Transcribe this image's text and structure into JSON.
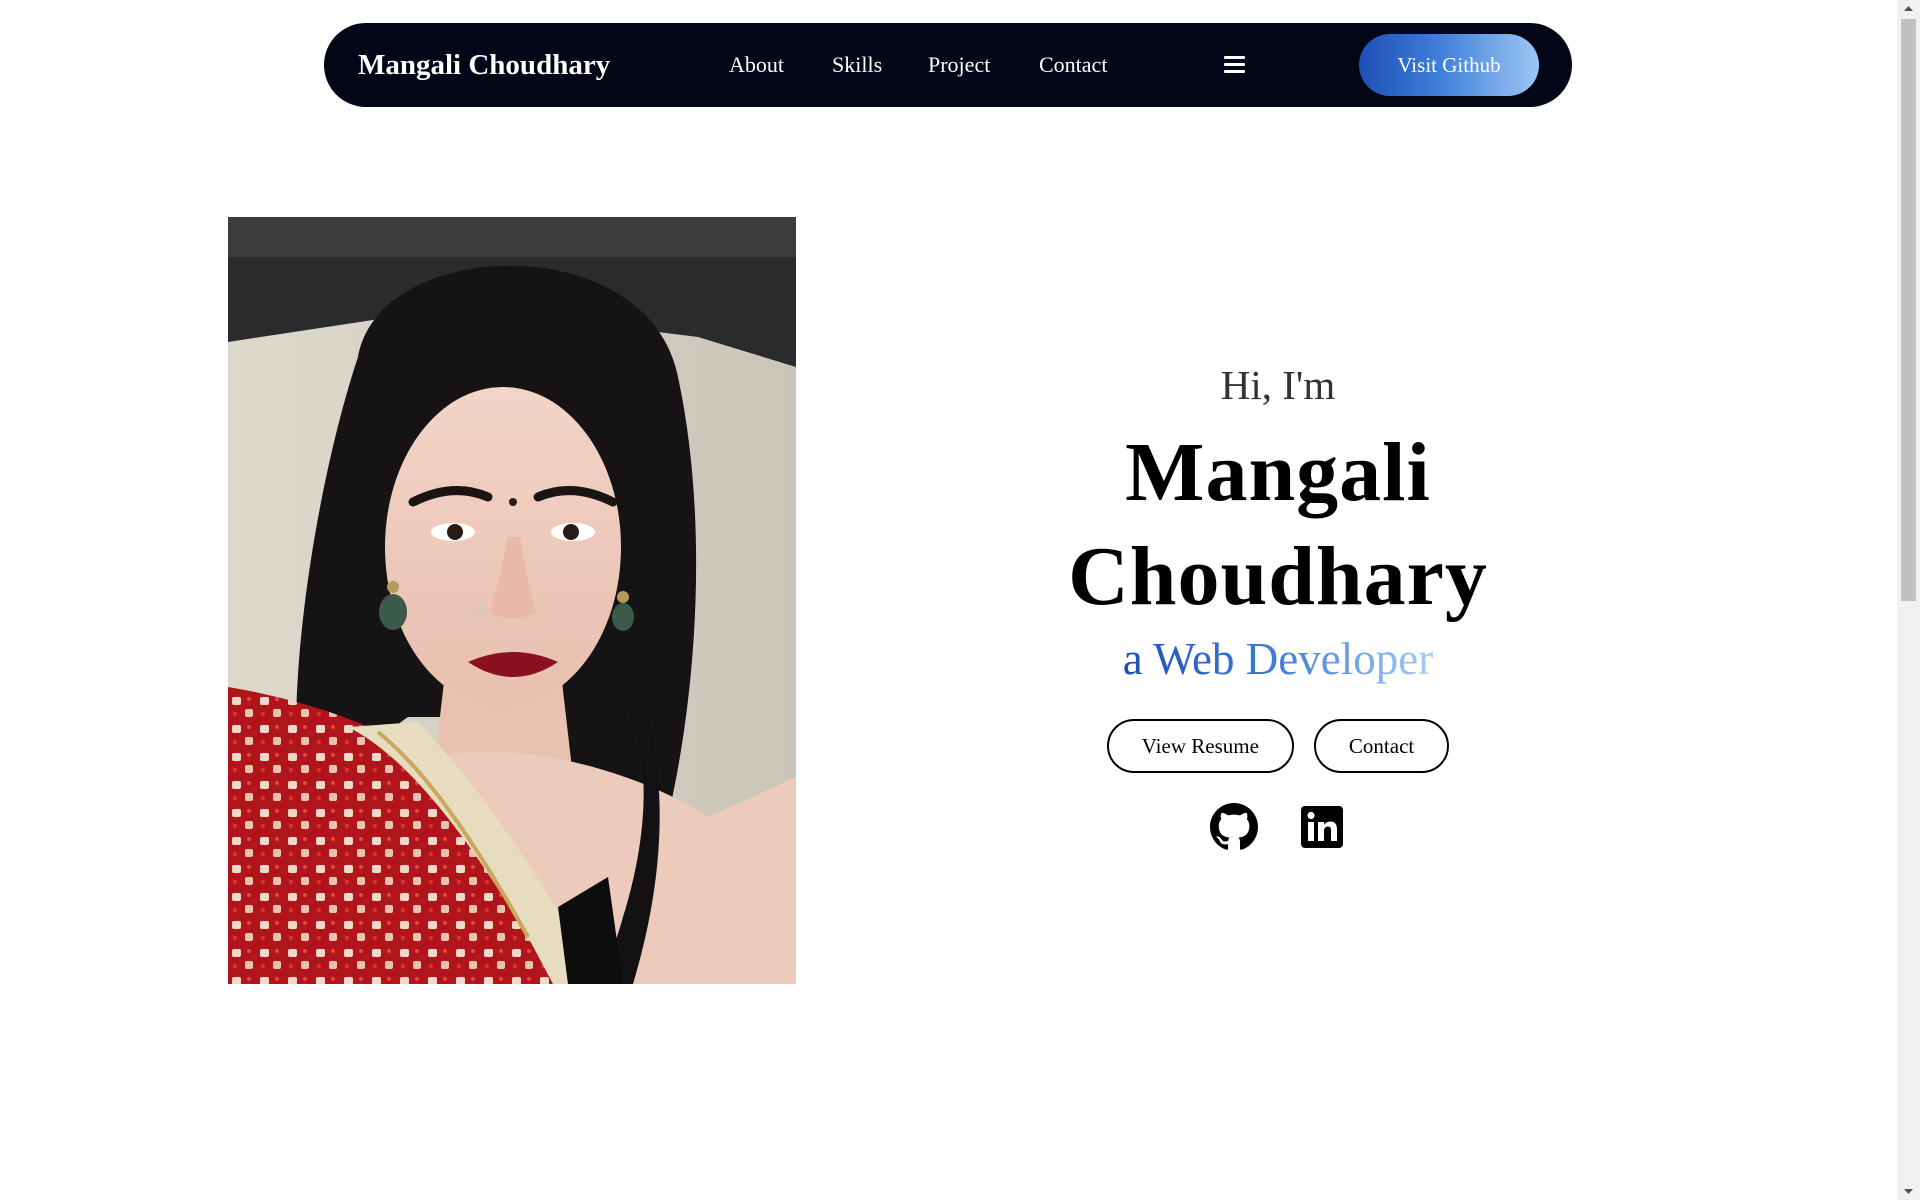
{
  "navbar": {
    "brand": "Mangali Choudhary",
    "links": [
      "About",
      "Skills",
      "Project",
      "Contact"
    ],
    "menu_icon": "hamburger-menu-icon",
    "cta_label": "Visit Github",
    "background_color": "#020617"
  },
  "hero": {
    "greeting": "Hi, I'm",
    "name_line1": "Mangali",
    "name_line2": "Choudhary",
    "role": "a Web Developer",
    "buttons": {
      "resume": "View Resume",
      "contact": "Contact"
    },
    "socials": [
      {
        "icon": "github-icon"
      },
      {
        "icon": "linkedin-icon"
      }
    ],
    "accent_gradient": [
      "#1c4fb5",
      "#3d7ed8",
      "#a7cbf5"
    ]
  },
  "photo": {
    "description_icon": "profile-photo"
  }
}
